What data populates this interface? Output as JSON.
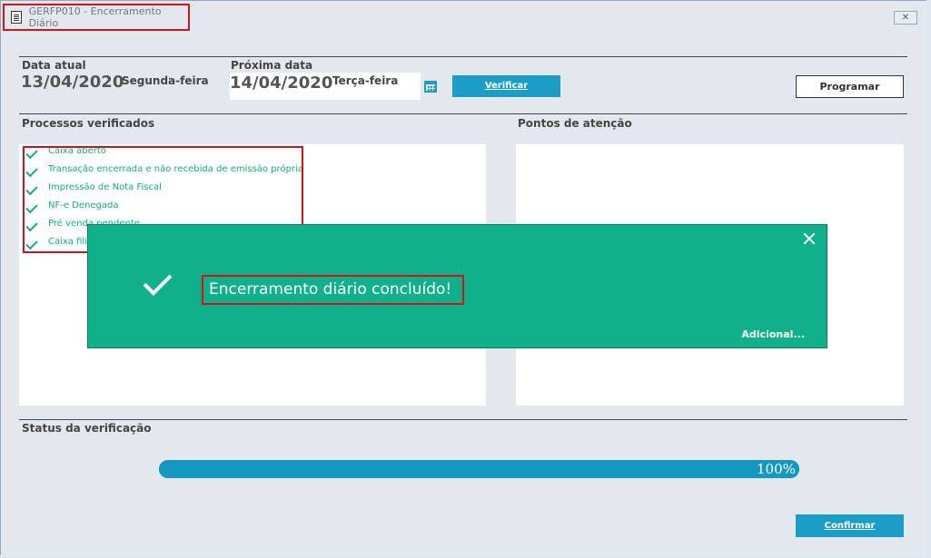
{
  "window": {
    "title": "GERFP010 - Encerramento Diário",
    "close_label": "✕"
  },
  "dates": {
    "current_label": "Data atual",
    "current_date": "13/04/2020",
    "current_day": "Segunda-feira",
    "next_label": "Próxima data",
    "next_date": "14/04/2020",
    "next_day": "Terça-feira"
  },
  "buttons": {
    "verify": "Verificar",
    "schedule": "Programar",
    "confirm": "Confirmar"
  },
  "sections": {
    "processes": "Processos verificados",
    "attention": "Pontos de atenção",
    "status": "Status da verificação"
  },
  "processes": [
    "Caixa aberto",
    "Transação encerrada e não recebida de emissão própria",
    "Impressão de Nota Fiscal",
    "NF-e Denegada",
    "Pré venda pendente",
    "Caixa filial"
  ],
  "toast": {
    "message": "Encerramento diário concluído!",
    "more_label": "Adicional..."
  },
  "progress": {
    "value": 100,
    "label": "100%"
  },
  "colors": {
    "accent": "#1a9ec6",
    "success": "#10b08a",
    "highlight": "#d4121b"
  }
}
